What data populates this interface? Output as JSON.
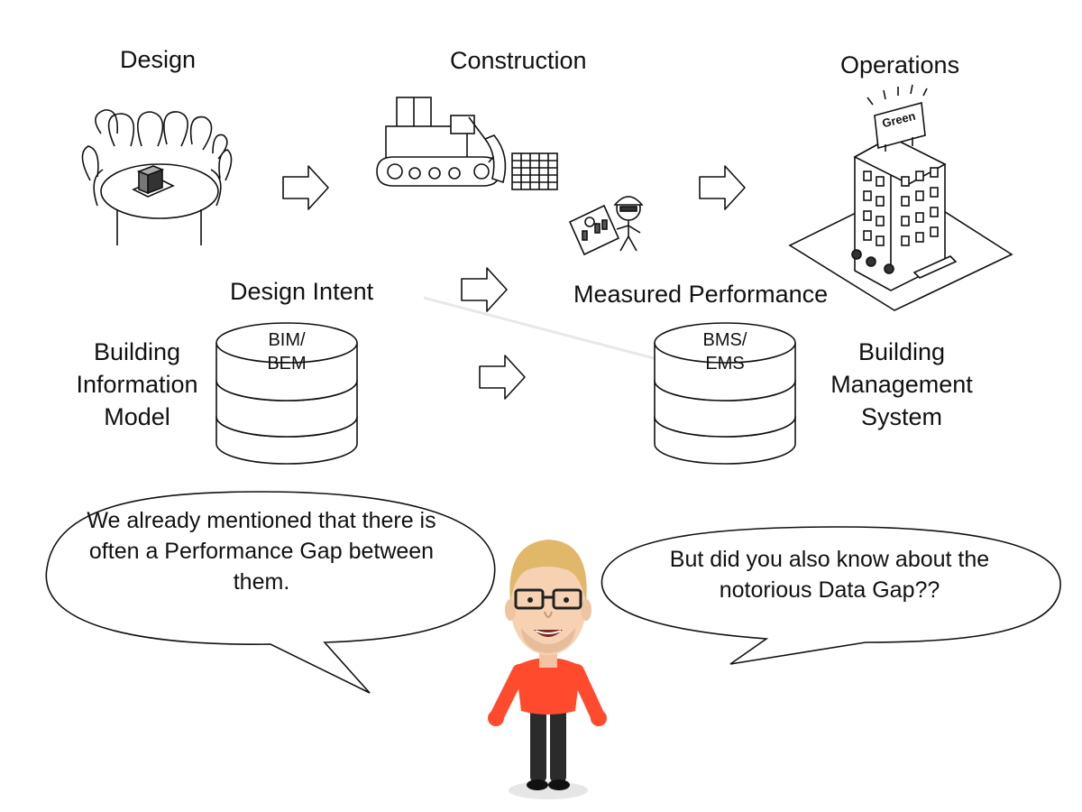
{
  "stages": {
    "design": "Design",
    "construction": "Construction",
    "operations": "Operations"
  },
  "building_sign": "Green",
  "flows": {
    "design_intent": "Design Intent",
    "measured_performance": "Measured Performance"
  },
  "databases": {
    "left": {
      "label_line1": "BIM/",
      "label_line2": "BEM"
    },
    "right": {
      "label_line1": "BMS/",
      "label_line2": "EMS"
    }
  },
  "systems": {
    "left": [
      "Building",
      "Information",
      "Model"
    ],
    "right": [
      "Building",
      "Management",
      "System"
    ]
  },
  "bubbles": {
    "left": "We already mentioned that there is often a Performance Gap between them.",
    "right": "But did you also know about the notorious Data Gap??"
  },
  "icons": {
    "arrow": "right-arrow-icon",
    "database": "database-cylinder-icon"
  },
  "colors": {
    "ink": "#111111",
    "shirt": "#ff4a2e",
    "pants": "#2b2b2b",
    "skin": "#f6d2b3",
    "hair": "#e1b86a"
  }
}
